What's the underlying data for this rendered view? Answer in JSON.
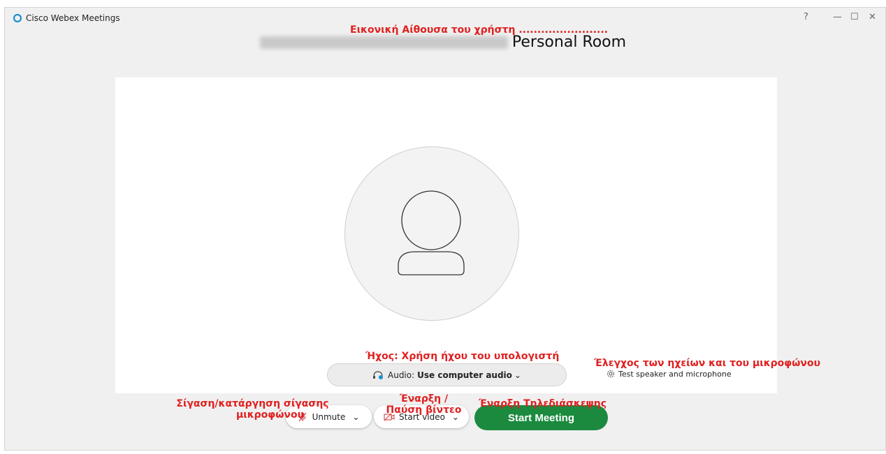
{
  "window": {
    "title": "Cisco Webex Meetings",
    "help_icon": "help-icon",
    "minimize_glyph": "—",
    "maximize_glyph": "☐",
    "close_glyph": "✕"
  },
  "room": {
    "title_suffix": "Personal Room"
  },
  "audio": {
    "label": "Audio:",
    "value": "Use computer audio",
    "chevron": "⌄",
    "icon": "headset-icon"
  },
  "test": {
    "label": "Test speaker and microphone",
    "icon": "gear-icon"
  },
  "controls": {
    "mute_label": "Unmute",
    "video_label": "Start video",
    "chevron": "⌄",
    "start_label": "Start Meeting"
  },
  "annotations": {
    "room": "Εικονική Αίθουσα του χρήστη ........................",
    "audio": "Ήχος: Χρήση ήχου του υπολογιστή",
    "test": "Έλεγχος των ηχείων και του μικροφώνου",
    "mute_line1": "Σίγαση/κατάργηση σίγασης",
    "mute_line2": "μικροφώνου",
    "video_line1": "Έναρξη /",
    "video_line2": "Παύση βίντεο",
    "start": "Έναρξη Τηλεδιάσκεψης"
  },
  "colors": {
    "start_button": "#1b8a3e",
    "annotation": "#e02020",
    "logo": "#1a8fd0"
  }
}
